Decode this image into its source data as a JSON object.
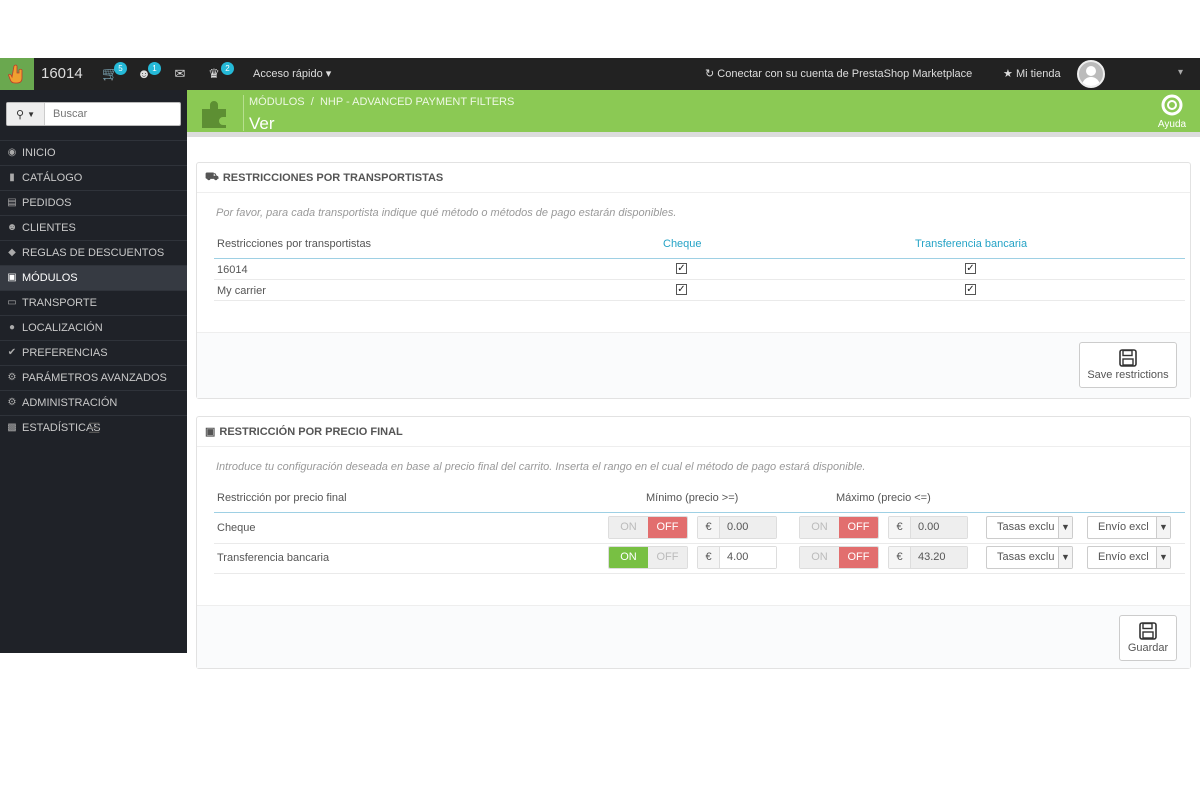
{
  "topbar": {
    "shop_name": "16014",
    "orders_badge": "5",
    "customers_badge": "1",
    "trophy_badge": "2",
    "quick_access": "Acceso rápido",
    "connect": "Conectar con su cuenta de PrestaShop Marketplace",
    "my_store": "Mi tienda"
  },
  "search": {
    "placeholder": "Buscar"
  },
  "sidebar": {
    "items": [
      {
        "label": "INICIO",
        "icon": "dashboard-icon"
      },
      {
        "label": "CATÁLOGO",
        "icon": "book-icon"
      },
      {
        "label": "PEDIDOS",
        "icon": "credit-card-icon"
      },
      {
        "label": "CLIENTES",
        "icon": "users-icon"
      },
      {
        "label": "REGLAS DE DESCUENTOS",
        "icon": "tag-icon"
      },
      {
        "label": "MÓDULOS",
        "icon": "puzzle-icon"
      },
      {
        "label": "TRANSPORTE",
        "icon": "truck-icon"
      },
      {
        "label": "LOCALIZACIÓN",
        "icon": "globe-icon"
      },
      {
        "label": "PREFERENCIAS",
        "icon": "wrench-icon"
      },
      {
        "label": "PARÁMETROS AVANZADOS",
        "icon": "cogs-icon"
      },
      {
        "label": "ADMINISTRACIÓN",
        "icon": "cog-icon"
      },
      {
        "label": "ESTADÍSTICAS",
        "icon": "bar-chart-icon"
      }
    ]
  },
  "header": {
    "breadcrumb_1": "MÓDULOS",
    "breadcrumb_sep": "/",
    "breadcrumb_2": "NHP - ADVANCED PAYMENT FILTERS",
    "title": "Ver",
    "help": "Ayuda",
    "color": "#8bc954"
  },
  "carriers_panel": {
    "title": "RESTRICCIONES POR TRANSPORTISTAS",
    "hint": "Por favor, para cada transportista indique qué método o métodos de pago estarán disponibles.",
    "col_0": "Restricciones por transportistas",
    "col_1": "Cheque",
    "col_2": "Transferencia bancaria",
    "rows": [
      {
        "name": "16014",
        "cheque": true,
        "transfer": true
      },
      {
        "name": "My carrier",
        "cheque": true,
        "transfer": true
      }
    ],
    "save_label": "Save restrictions"
  },
  "price_panel": {
    "title": "RESTRICCIÓN POR PRECIO FINAL",
    "hint": "Introduce tu configuración deseada en base al precio final del carrito. Inserta el rango en el cual el método de pago estará disponible.",
    "col_0": "Restricción por precio final",
    "col_min": "Mínimo (precio >=)",
    "col_max": "Máximo (precio <=)",
    "on": "ON",
    "off": "OFF",
    "currency": "€",
    "rows": [
      {
        "name": "Cheque",
        "min_enabled": false,
        "min": "0.00",
        "max_enabled": false,
        "max": "0.00",
        "tax": "Tasas exclu",
        "shipping": "Envío excl"
      },
      {
        "name": "Transferencia bancaria",
        "min_enabled": true,
        "min": "4.00",
        "max_enabled": false,
        "max": "43.20",
        "tax": "Tasas exclu",
        "shipping": "Envío excl"
      }
    ],
    "save_label": "Guardar"
  }
}
